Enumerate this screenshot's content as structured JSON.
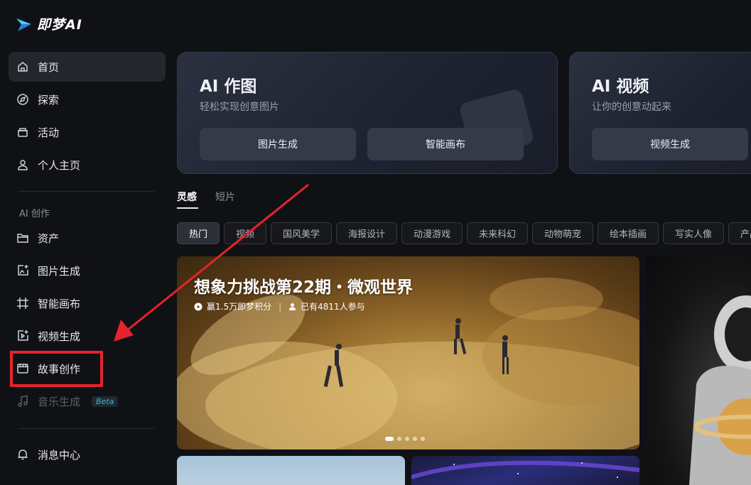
{
  "app": {
    "logo_text": "即梦AI"
  },
  "sidebar": {
    "items": [
      {
        "label": "首页",
        "icon": "home-icon"
      },
      {
        "label": "探索",
        "icon": "compass-icon"
      },
      {
        "label": "活动",
        "icon": "gift-icon"
      },
      {
        "label": "个人主页",
        "icon": "user-icon"
      }
    ],
    "section_title": "AI 创作",
    "creation_items": [
      {
        "label": "资产",
        "icon": "folder-icon"
      },
      {
        "label": "图片生成",
        "icon": "image-plus-icon"
      },
      {
        "label": "智能画布",
        "icon": "canvas-icon"
      },
      {
        "label": "视频生成",
        "icon": "video-plus-icon"
      },
      {
        "label": "故事创作",
        "icon": "story-icon"
      },
      {
        "label": "音乐生成",
        "icon": "music-icon",
        "badge": "Beta"
      }
    ],
    "bottom_items": [
      {
        "label": "消息中心",
        "icon": "bell-icon"
      }
    ]
  },
  "cards": [
    {
      "title": "AI 作图",
      "subtitle": "轻松实现创意图片",
      "buttons": [
        "图片生成",
        "智能画布"
      ]
    },
    {
      "title": "AI 视频",
      "subtitle": "让你的创意动起来",
      "buttons": [
        "视频生成"
      ]
    }
  ],
  "tabs": [
    "灵感",
    "短片"
  ],
  "chips": [
    "热门",
    "视频",
    "国风美学",
    "海报设计",
    "动漫游戏",
    "未来科幻",
    "动物萌宠",
    "绘本插画",
    "写实人像",
    "产品"
  ],
  "banner": {
    "title": "想象力挑战第22期・微观世界",
    "reward": "赢1.5万即梦积分",
    "participants": "已有4811人参与"
  },
  "colors": {
    "accent": "#3fb4c9",
    "highlight": "#e5242b",
    "background": "#101115"
  }
}
